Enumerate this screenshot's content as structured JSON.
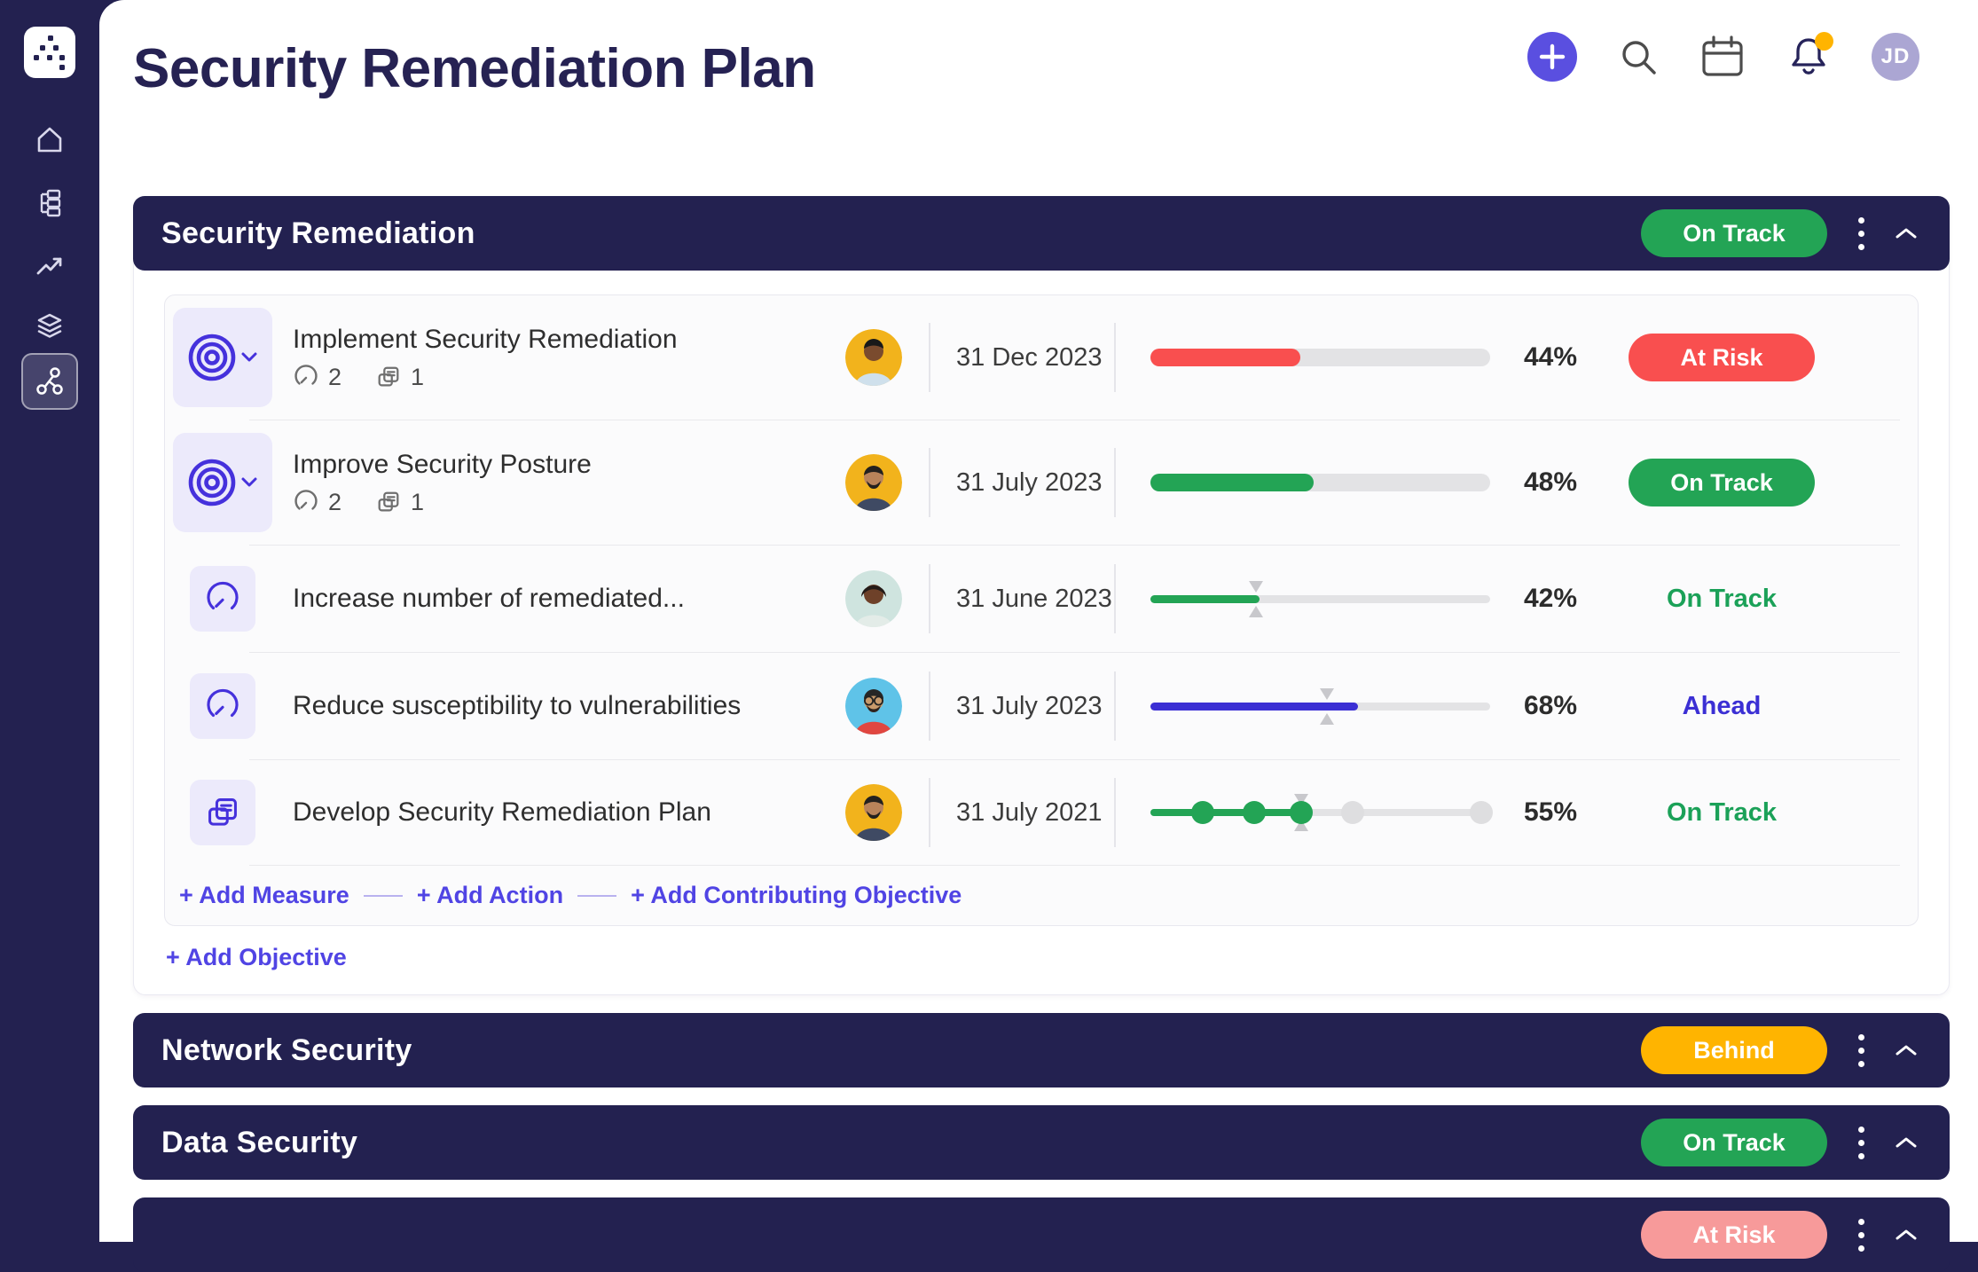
{
  "page_title": "Security Remediation Plan",
  "topbar": {
    "avatar_initials": "JD",
    "icons": [
      "plus-icon",
      "search-icon",
      "calendar-icon",
      "bell-icon-with-badge",
      "user-avatar"
    ]
  },
  "sidebar": {
    "items": [
      "app-logo",
      "home",
      "hierarchy",
      "trending",
      "layers",
      "network"
    ],
    "active_item": "network"
  },
  "colors": {
    "navy": "#232150",
    "accent_indigo": "#4531DC",
    "plus_button": "#5A4FE0",
    "green": "#23A455",
    "green_text": "#1BA158",
    "red": "#F94F4F",
    "yellow": "#FFB400",
    "pink": "#F79A9A",
    "indigo_bar": "#3B2FD4",
    "link_purple": "#5044E4",
    "notification_dot": "#FFB400"
  },
  "sections": [
    {
      "title": "Security Remediation",
      "status": "On Track",
      "rows": [
        {
          "kind": "objective",
          "title": "Implement Security Remediation",
          "measure_count": "2",
          "action_count": "1",
          "due_date": "31 Dec 2023",
          "percent": "44%",
          "progress": 44,
          "bar_color": "#F94F4F",
          "status": "At Risk"
        },
        {
          "kind": "objective",
          "title": "Improve Security Posture",
          "measure_count": "2",
          "action_count": "1",
          "due_date": "31 July 2023",
          "percent": "48%",
          "progress": 48,
          "bar_color": "#23A455",
          "status": "On Track"
        },
        {
          "kind": "measure",
          "title": "Increase number of remediated...",
          "due_date": "31 June 2023",
          "percent": "42%",
          "progress": 32,
          "marker": 31,
          "bar_color": "#23A455",
          "status": "On Track"
        },
        {
          "kind": "measure",
          "title": "Reduce susceptibility to vulnerabilities",
          "due_date": "31 July 2023",
          "percent": "68%",
          "progress": 61,
          "marker": 52,
          "bar_color": "#3B2FD4",
          "status": "Ahead"
        },
        {
          "kind": "action",
          "title": "Develop Security Remediation Plan",
          "due_date": "31 July 2021",
          "percent": "55%",
          "progress": 44.5,
          "marker": 44.5,
          "bar_color": "#23A455",
          "milestones": [
            {
              "pos": 15.5,
              "done": true
            },
            {
              "pos": 30.5,
              "done": true
            },
            {
              "pos": 44.5,
              "done": true
            },
            {
              "pos": 59.5,
              "done": false
            },
            {
              "pos": 97.5,
              "done": false
            }
          ],
          "status": "On Track"
        }
      ],
      "footer_links": [
        "+ Add Measure",
        "+ Add Action",
        "+ Add Contributing Objective"
      ],
      "add_objective_label": "+ Add Objective"
    },
    {
      "title": "Network Security",
      "status": "Behind"
    },
    {
      "title": "Data Security",
      "status": "On Track"
    },
    {
      "title": "",
      "status": "At Risk"
    }
  ]
}
